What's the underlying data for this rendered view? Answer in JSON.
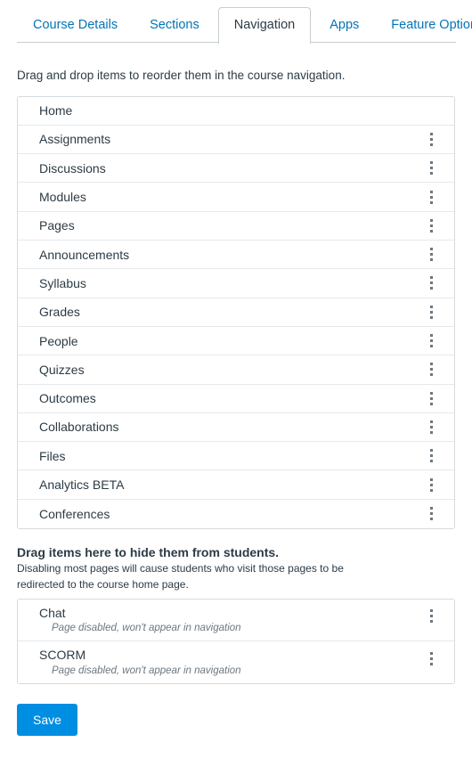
{
  "tabs": [
    {
      "label": "Course Details",
      "active": false
    },
    {
      "label": "Sections",
      "active": false
    },
    {
      "label": "Navigation",
      "active": true
    },
    {
      "label": "Apps",
      "active": false
    },
    {
      "label": "Feature Options",
      "active": false
    }
  ],
  "main": {
    "intro_text": "Drag and drop items to reorder them in the course navigation.",
    "enabled_items": [
      {
        "label": "Home",
        "has_menu": false
      },
      {
        "label": "Assignments",
        "has_menu": true
      },
      {
        "label": "Discussions",
        "has_menu": true
      },
      {
        "label": "Modules",
        "has_menu": true
      },
      {
        "label": "Pages",
        "has_menu": true
      },
      {
        "label": "Announcements",
        "has_menu": true
      },
      {
        "label": "Syllabus",
        "has_menu": true
      },
      {
        "label": "Grades",
        "has_menu": true
      },
      {
        "label": "People",
        "has_menu": true
      },
      {
        "label": "Quizzes",
        "has_menu": true
      },
      {
        "label": "Outcomes",
        "has_menu": true
      },
      {
        "label": "Collaborations",
        "has_menu": true
      },
      {
        "label": "Files",
        "has_menu": true
      },
      {
        "label": "Analytics BETA",
        "has_menu": true
      },
      {
        "label": "Conferences",
        "has_menu": true
      }
    ],
    "disabled_section": {
      "heading": "Drag items here to hide them from students.",
      "description": "Disabling most pages will cause students who visit those pages to be redirected to the course home page.",
      "items": [
        {
          "label": "Chat",
          "note": "Page disabled, won't appear in navigation",
          "has_menu": true
        },
        {
          "label": "SCORM",
          "note": "Page disabled, won't appear in navigation",
          "has_menu": true
        }
      ]
    },
    "save_label": "Save"
  },
  "colors": {
    "link": "#0374B5",
    "text": "#2D3B45",
    "muted": "#6B7780",
    "border": "#D7DADE",
    "row_border": "#E6E8EA",
    "accent": "#008EE2",
    "background": "#FFFFFF"
  }
}
